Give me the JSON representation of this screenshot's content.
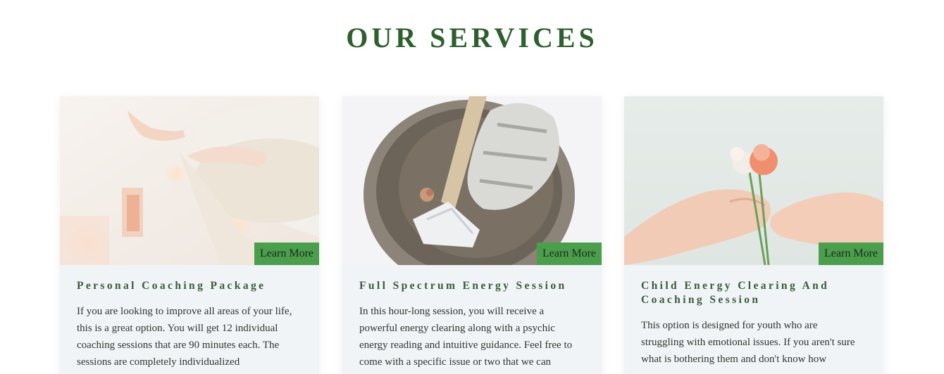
{
  "section": {
    "title": "OUR SERVICES"
  },
  "cards": [
    {
      "title": "Personal Coaching Package",
      "button": "Learn More",
      "image_icon": "meditation-photo",
      "text": "If you are looking to improve all areas of your life, this is a great option. You will get 12 individual coaching sessions that are 90 minutes each. The sessions are completely individualized"
    },
    {
      "title": "Full Spectrum Energy Session",
      "button": "Learn More",
      "image_icon": "sage-bowl-photo",
      "text": "In this hour-long session, you will receive a powerful energy clearing along with a psychic energy reading and intuitive guidance. Feel free to come with a specific issue or two that we can"
    },
    {
      "title": "Child Energy Clearing And Coaching Session",
      "button": "Learn More",
      "image_icon": "flowers-hands-photo",
      "text": "This option is designed for youth who are struggling with emotional issues. If you aren't sure what is bothering them and don't know how"
    }
  ],
  "colors": {
    "title": "#2f5e2f",
    "button_bg": "#4a9e4c",
    "card_bg": "#f0f4f6",
    "card_title": "#3a5a3a"
  }
}
